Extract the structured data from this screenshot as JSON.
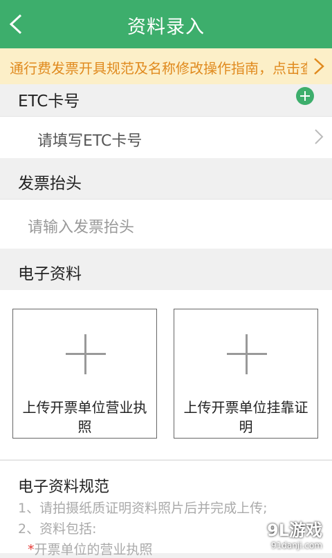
{
  "header": {
    "title": "资料录入",
    "back_icon": "chevron-left-icon"
  },
  "notice": {
    "text": "通行费发票开具规范及名称修改操作指南，点击查看",
    "arrow_icon": "chevron-right-icon"
  },
  "etc": {
    "section_label": "ETC卡号",
    "add_icon": "plus-circle-icon",
    "placeholder": "请填写ETC卡号"
  },
  "invoice": {
    "section_label": "发票抬头",
    "placeholder": "请输入发票抬头"
  },
  "documents": {
    "section_label": "电子资料",
    "uploads": [
      {
        "label": "上传开票单位营业执照"
      },
      {
        "label": "上传开票单位挂靠证明"
      }
    ]
  },
  "rules": {
    "title": "电子资料规范",
    "line1": "1、请拍摄纸质证明资料照片后并完成上传;",
    "line2": "2、资料包括:",
    "item1_star": "*",
    "item1": "开票单位的营业执照"
  },
  "watermark": {
    "main": "9L游戏",
    "sub": "91danji.com"
  },
  "colors": {
    "brand_green": "#3dae6c",
    "notice_bg": "#fcefc8",
    "notice_text": "#e08a1e"
  }
}
